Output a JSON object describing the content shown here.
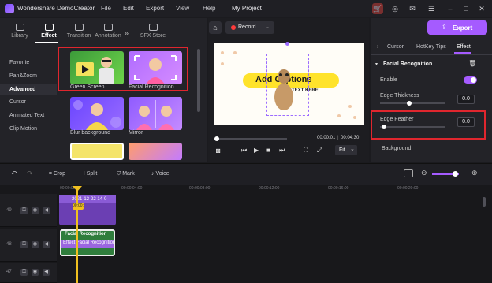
{
  "app": {
    "title": "Wondershare DemoCreator",
    "menu": [
      "File",
      "Edit",
      "Export",
      "View",
      "Help"
    ],
    "project": "My Project",
    "export_label": "Export",
    "accent": "#a55bff"
  },
  "left_panel": {
    "tabs": [
      {
        "label": "Library",
        "icon": "library-icon"
      },
      {
        "label": "Effect",
        "icon": "effect-icon"
      },
      {
        "label": "Transition",
        "icon": "transition-icon"
      },
      {
        "label": "Annotation",
        "icon": "annotation-icon"
      },
      {
        "label": "SFX Store",
        "icon": "sfx-store-icon"
      }
    ],
    "more_label": "»",
    "categories": [
      "Favorite",
      "Pan&Zoom",
      "Advanced",
      "Cursor",
      "Animated Text",
      "Clip Motion"
    ],
    "active_category": "Advanced",
    "effects": [
      "Green Screen",
      "Facial Recognition",
      "Blur background",
      "Mirror"
    ]
  },
  "preview": {
    "record_label": "Record",
    "caption_text": "Add Captions",
    "subtext": "TEXT HERE",
    "time_current": "00:00:01",
    "time_total": "00:04:30",
    "fit_label": "Fit"
  },
  "right_panel": {
    "tabs": [
      "Cursor",
      "HotKey Tips",
      "Effect"
    ],
    "active_tab": "Effect",
    "section_title": "Facial Recognition",
    "enable_label": "Enable",
    "enable_on": true,
    "edge_thickness_label": "Edge Thickness",
    "edge_thickness_value": "0.0",
    "edge_thickness_level": 0.45,
    "edge_feather_label": "Edge Feather",
    "edge_feather_value": "0.0",
    "edge_feather_level": 0.03,
    "background_label": "Background"
  },
  "timeline": {
    "tools": [
      "Crop",
      "Split",
      "Mark",
      "Voice"
    ],
    "ticks": [
      "00:00:00:00",
      "00:00:04:00",
      "00:00:08:00",
      "00:00:12:00",
      "00:00:16:00",
      "00:00:20:00"
    ],
    "tracks": [
      "49",
      "48",
      "47"
    ],
    "clip1_label": "2021-12-22 14-0",
    "clip2_label": "Facial Recognition",
    "clip2_sub": "Effect Facial Recognition",
    "playhead_label": "00:00:01:10"
  }
}
